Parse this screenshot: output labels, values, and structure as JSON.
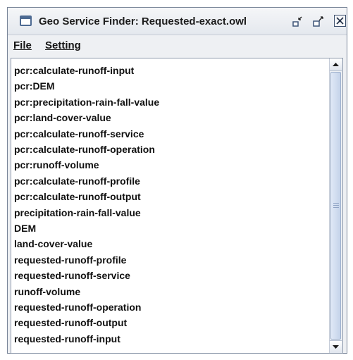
{
  "window": {
    "title": "Geo Service Finder: Requested-exact.owl",
    "icons": {
      "app": "window-icon",
      "minimize": "minimize-icon",
      "maximize": "maximize-icon",
      "close": "close-icon"
    }
  },
  "menubar": {
    "items": [
      "File",
      "Setting"
    ]
  },
  "list": {
    "items": [
      "pcr:calculate-runoff-input",
      "pcr:DEM",
      "pcr:precipitation-rain-fall-value",
      "pcr:land-cover-value",
      "pcr:calculate-runoff-service",
      "pcr:calculate-runoff-operation",
      "pcr:runoff-volume",
      "pcr:calculate-runoff-profile",
      "pcr:calculate-runoff-output",
      "precipitation-rain-fall-value",
      "DEM",
      "land-cover-value",
      "requested-runoff-profile",
      "requested-runoff-service",
      "runoff-volume",
      "requested-runoff-operation",
      "requested-runoff-output",
      "requested-runoff-input"
    ]
  },
  "colors": {
    "window_bg": "#eef0f3",
    "border": "#7a8699",
    "scroll_thumb": "#c4d3ea"
  }
}
